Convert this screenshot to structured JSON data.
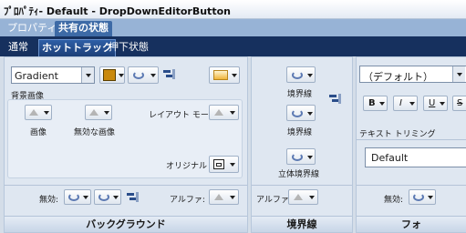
{
  "window": {
    "title": "ﾌﾟﾛﾊﾟﾃｨ- Default - DropDownEditorButton"
  },
  "top_tabs": [
    {
      "label": "プロパティ",
      "active": false
    },
    {
      "label": "共有の状態",
      "active": true
    }
  ],
  "state_tabs": [
    {
      "label": "通常",
      "active": false
    },
    {
      "label": "ホットトラック",
      "active": true
    },
    {
      "label": "押下状態",
      "active": false
    }
  ],
  "background": {
    "style_value": "Gradient",
    "accent_color": "#c9890d",
    "bg_image_label": "背景画像",
    "image_label": "画像",
    "disabled_image_label": "無効な画像",
    "layout_mode_label": "レイアウト モード:",
    "original_label": "オリジナル",
    "disabled_label": "無効:",
    "alpha_label": "アルファ:",
    "footer": "バックグラウンド"
  },
  "border": {
    "border_label": "境界線",
    "border_label_2": "境界線",
    "border_3d_label": "立体境界線",
    "alpha_label": "アルファ:",
    "footer": "境界線"
  },
  "font": {
    "font_value": "（デフォルト）",
    "bold_label": "B",
    "italic_label": "I",
    "underline_label": "U",
    "strikeout_label": "S",
    "text_trimming_label": "テキスト トリミング",
    "trimming_value": "Default",
    "disabled_label": "無効:",
    "footer": "フォ"
  }
}
